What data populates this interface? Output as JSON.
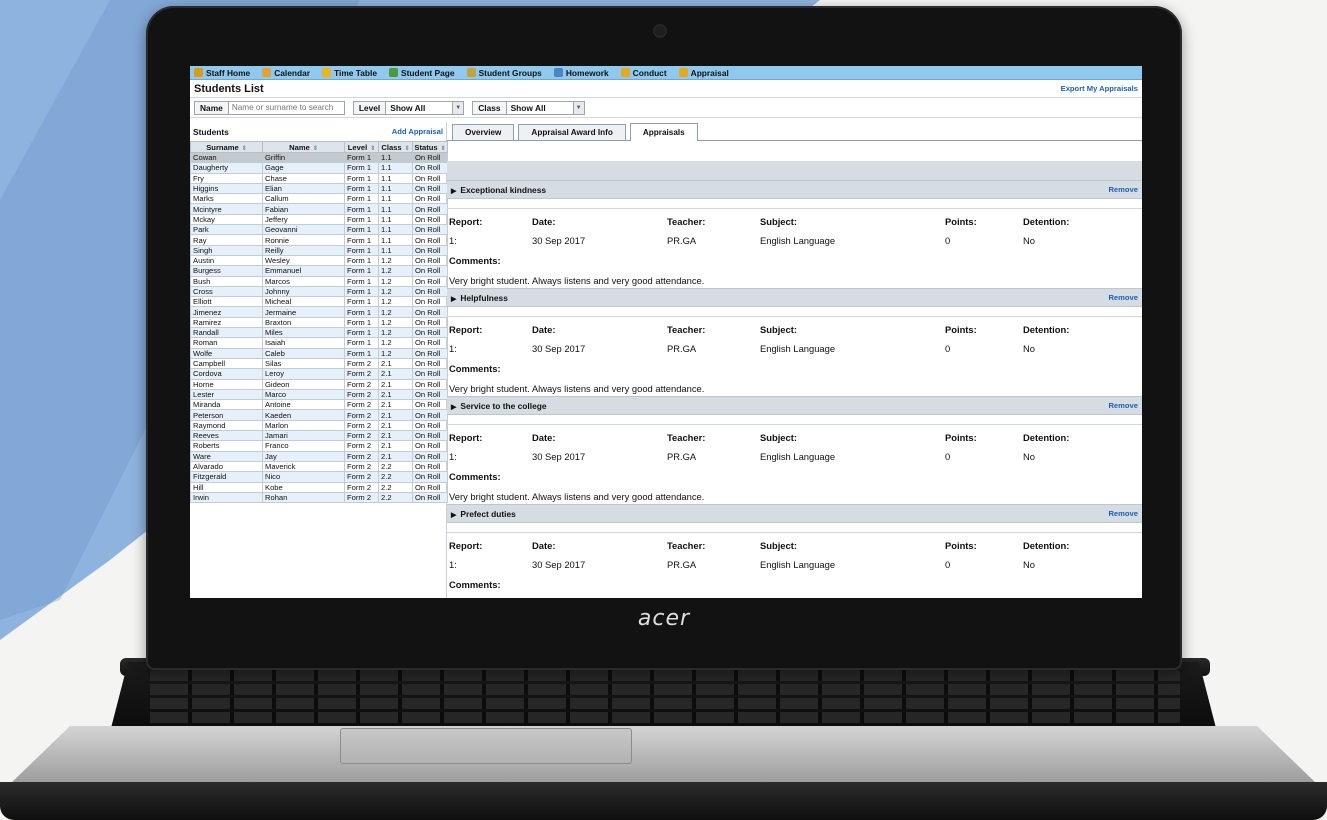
{
  "brand": "acer",
  "nav": [
    {
      "label": "Staff Home",
      "icon": "home-icon",
      "color": "#d99a1e"
    },
    {
      "label": "Calendar",
      "icon": "calendar-icon",
      "color": "#e2a13a"
    },
    {
      "label": "Time Table",
      "icon": "timetable-icon",
      "color": "#f0b21e"
    },
    {
      "label": "Student Page",
      "icon": "student-icon",
      "color": "#4b9a3a"
    },
    {
      "label": "Student Groups",
      "icon": "groups-icon",
      "color": "#c9a13a"
    },
    {
      "label": "Homework",
      "icon": "homework-icon",
      "color": "#4a86c5"
    },
    {
      "label": "Conduct",
      "icon": "conduct-icon",
      "color": "#e6a81f"
    },
    {
      "label": "Appraisal",
      "icon": "appraisal-icon",
      "color": "#e6a81f"
    }
  ],
  "header": {
    "title": "Students List",
    "export_label": "Export My Appraisals"
  },
  "filters": {
    "name_label": "Name",
    "name_placeholder": "Name or surname to search",
    "level_label": "Level",
    "level_value": "Show All",
    "class_label": "Class",
    "class_value": "Show All"
  },
  "students": {
    "label": "Students",
    "add_label": "Add Appraisal",
    "columns": [
      "Surname",
      "Name",
      "Level",
      "Class",
      "Status"
    ],
    "rows": [
      [
        "Cowan",
        "Griffin",
        "Form 1",
        "1.1",
        "On Roll"
      ],
      [
        "Daugherty",
        "Gage",
        "Form 1",
        "1.1",
        "On Roll"
      ],
      [
        "Fry",
        "Chase",
        "Form 1",
        "1.1",
        "On Roll"
      ],
      [
        "Higgins",
        "Elian",
        "Form 1",
        "1.1",
        "On Roll"
      ],
      [
        "Marks",
        "Callum",
        "Form 1",
        "1.1",
        "On Roll"
      ],
      [
        "Mcintyre",
        "Fabian",
        "Form 1",
        "1.1",
        "On Roll"
      ],
      [
        "Mckay",
        "Jeffery",
        "Form 1",
        "1.1",
        "On Roll"
      ],
      [
        "Park",
        "Geovanni",
        "Form 1",
        "1.1",
        "On Roll"
      ],
      [
        "Ray",
        "Ronnie",
        "Form 1",
        "1.1",
        "On Roll"
      ],
      [
        "Singh",
        "Reilly",
        "Form 1",
        "1.1",
        "On Roll"
      ],
      [
        "Austin",
        "Wesley",
        "Form 1",
        "1.2",
        "On Roll"
      ],
      [
        "Burgess",
        "Emmanuel",
        "Form 1",
        "1.2",
        "On Roll"
      ],
      [
        "Bush",
        "Marcos",
        "Form 1",
        "1.2",
        "On Roll"
      ],
      [
        "Cross",
        "Johnny",
        "Form 1",
        "1.2",
        "On Roll"
      ],
      [
        "Elliott",
        "Micheal",
        "Form 1",
        "1.2",
        "On Roll"
      ],
      [
        "Jimenez",
        "Jermaine",
        "Form 1",
        "1.2",
        "On Roll"
      ],
      [
        "Ramirez",
        "Braxton",
        "Form 1",
        "1.2",
        "On Roll"
      ],
      [
        "Randall",
        "Miles",
        "Form 1",
        "1.2",
        "On Roll"
      ],
      [
        "Roman",
        "Isaiah",
        "Form 1",
        "1.2",
        "On Roll"
      ],
      [
        "Wolfe",
        "Caleb",
        "Form 1",
        "1.2",
        "On Roll"
      ],
      [
        "Campbell",
        "Silas",
        "Form 2",
        "2.1",
        "On Roll"
      ],
      [
        "Cordova",
        "Leroy",
        "Form 2",
        "2.1",
        "On Roll"
      ],
      [
        "Horne",
        "Gideon",
        "Form 2",
        "2.1",
        "On Roll"
      ],
      [
        "Lester",
        "Marco",
        "Form 2",
        "2.1",
        "On Roll"
      ],
      [
        "Miranda",
        "Antoine",
        "Form 2",
        "2.1",
        "On Roll"
      ],
      [
        "Peterson",
        "Kaeden",
        "Form 2",
        "2.1",
        "On Roll"
      ],
      [
        "Raymond",
        "Marlon",
        "Form 2",
        "2.1",
        "On Roll"
      ],
      [
        "Reeves",
        "Jamari",
        "Form 2",
        "2.1",
        "On Roll"
      ],
      [
        "Roberts",
        "Franco",
        "Form 2",
        "2.1",
        "On Roll"
      ],
      [
        "Ware",
        "Jay",
        "Form 2",
        "2.1",
        "On Roll"
      ],
      [
        "Alvarado",
        "Maverick",
        "Form 2",
        "2.2",
        "On Roll"
      ],
      [
        "Fitzgerald",
        "Nico",
        "Form 2",
        "2.2",
        "On Roll"
      ],
      [
        "Hill",
        "Kobe",
        "Form 2",
        "2.2",
        "On Roll"
      ],
      [
        "Irwin",
        "Rohan",
        "Form 2",
        "2.2",
        "On Roll"
      ]
    ]
  },
  "tabs": [
    {
      "label": "Overview",
      "active": false
    },
    {
      "label": "Appraisal Award Info",
      "active": false
    },
    {
      "label": "Appraisals",
      "active": true
    }
  ],
  "field_labels": {
    "report": "Report:",
    "date": "Date:",
    "teacher": "Teacher:",
    "subject": "Subject:",
    "points": "Points:",
    "detention": "Detention:",
    "comments": "Comments:"
  },
  "appraisals": [
    {
      "title": "Exceptional kindness",
      "remove": "Remove",
      "report": "1:",
      "date": "30 Sep 2017",
      "teacher": "PR.GA",
      "subject": "English Language",
      "points": "0",
      "detention": "No",
      "comment": "Very bright student. Always listens and very good attendance."
    },
    {
      "title": "Helpfulness",
      "remove": "Remove",
      "report": "1:",
      "date": "30 Sep 2017",
      "teacher": "PR.GA",
      "subject": "English Language",
      "points": "0",
      "detention": "No",
      "comment": "Very bright student. Always listens and very good attendance."
    },
    {
      "title": "Service to the college",
      "remove": "Remove",
      "report": "1:",
      "date": "30 Sep 2017",
      "teacher": "PR.GA",
      "subject": "English Language",
      "points": "0",
      "detention": "No",
      "comment": "Very bright student. Always listens and very good attendance."
    },
    {
      "title": "Prefect duties",
      "remove": "Remove",
      "report": "1:",
      "date": "30 Sep 2017",
      "teacher": "PR.GA",
      "subject": "English Language",
      "points": "0",
      "detention": "No",
      "comment": ""
    }
  ]
}
